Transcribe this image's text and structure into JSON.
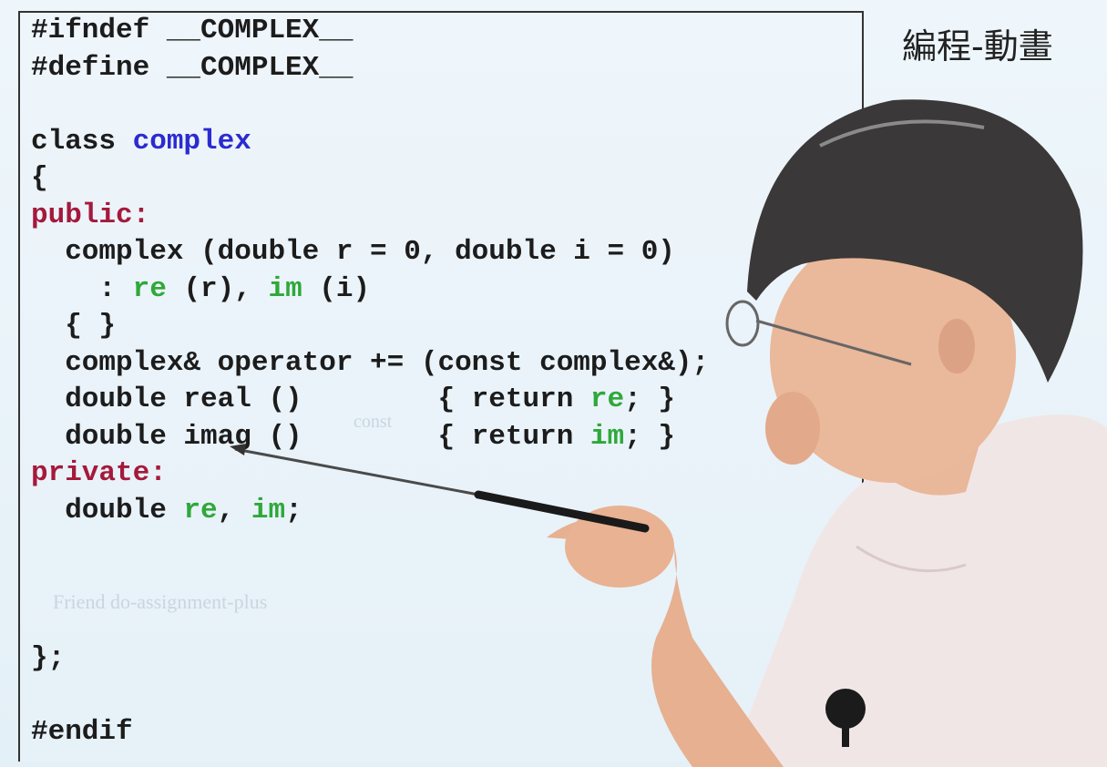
{
  "watermark": "編程-動畫",
  "code": {
    "l1": [
      "#ifndef ",
      "__COMPLEX__"
    ],
    "l2": [
      "#define ",
      "__COMPLEX__"
    ],
    "l4": [
      "class ",
      "complex"
    ],
    "l5": "{",
    "l6": "public:",
    "l7": "  complex (double r = 0, double i = 0)",
    "l8": [
      "    : ",
      "re",
      " (r), ",
      "im",
      " (i)"
    ],
    "l9": "  { }",
    "l10": "  complex& operator += (const complex&);",
    "l11": [
      "  double real ()        { return ",
      "re",
      "; }"
    ],
    "l12": [
      "  double imag ()        { return ",
      "im",
      "; }"
    ],
    "l13": "private:",
    "l14": [
      "  double ",
      "re",
      ", ",
      "im",
      ";"
    ],
    "l18": "};",
    "l20": "#endif"
  },
  "faint_notes": {
    "const": "const",
    "friend": "Friend do-assignment-plus"
  },
  "colors": {
    "class_name": "#2b2bd0",
    "access_specifier": "#a5193c",
    "member": "#2fa83a"
  }
}
